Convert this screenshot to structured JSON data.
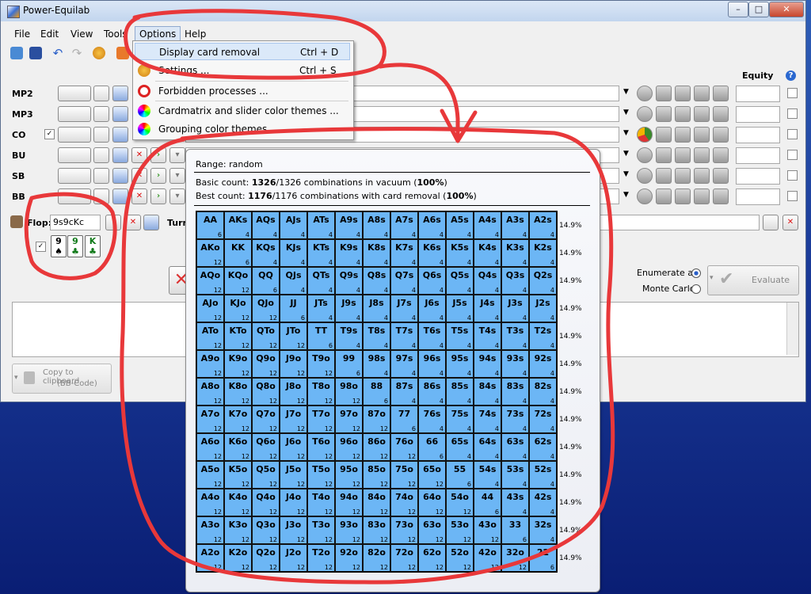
{
  "app": {
    "title": "Power-Equilab"
  },
  "menu": [
    "File",
    "Edit",
    "View",
    "Tools",
    "Options",
    "Help"
  ],
  "options_menu": [
    {
      "label": "Display card removal",
      "shortcut": "Ctrl + D",
      "icon": "none"
    },
    {
      "label": "Settings ...",
      "shortcut": "Ctrl + S",
      "icon": "gear-icon"
    },
    {
      "label": "Forbidden processes ...",
      "shortcut": "",
      "icon": "forbidden-icon"
    },
    {
      "label": "Cardmatrix and slider color themes ...",
      "shortcut": "",
      "icon": "color-wheel-icon"
    },
    {
      "label": "Grouping color themes ...",
      "shortcut": "",
      "icon": "color-wheel-icon"
    }
  ],
  "equity_header": "Equity",
  "players": [
    "MP2",
    "MP3",
    "CO",
    "BU",
    "SB",
    "BB"
  ],
  "flop": {
    "label": "Flop:",
    "value": "9s9cKc",
    "cards": [
      {
        "rank": "9",
        "suit": "♠",
        "color": "#000"
      },
      {
        "rank": "9",
        "suit": "♣",
        "color": "#127a1a"
      },
      {
        "rank": "K",
        "suit": "♣",
        "color": "#127a1a"
      }
    ]
  },
  "turn_label": "Turn",
  "evaluate": {
    "enumerate": "Enumerate all",
    "monte": "Monte Carlo",
    "button": "Evaluate"
  },
  "clipboard": {
    "line1": "Copy to clipboard",
    "line2": "(BB-Code)"
  },
  "popup": {
    "range_label": "Range: ",
    "range_value": "random",
    "basic": {
      "prefix": "Basic count: ",
      "num": "1326",
      "rest": "/1326 combinations in vacuum (",
      "pct": "100%",
      "end": ")"
    },
    "best": {
      "prefix": "Best count: ",
      "num": "1176",
      "rest": "/1176 combinations with card removal (",
      "pct": "100%",
      "end": ")"
    }
  },
  "matrix_ranks": [
    "A",
    "K",
    "Q",
    "J",
    "T",
    "9",
    "8",
    "7",
    "6",
    "5",
    "4",
    "3",
    "2"
  ],
  "matrix_counts": [
    [
      "6",
      "4",
      "4",
      "4",
      "4",
      "4",
      "4",
      "4",
      "4",
      "4",
      "4",
      "4",
      "4"
    ],
    [
      "12",
      "6",
      "4",
      "4",
      "4",
      "4",
      "4",
      "4",
      "4",
      "4",
      "4",
      "4",
      "4"
    ],
    [
      "12",
      "12",
      "6",
      "4",
      "4",
      "4",
      "4",
      "4",
      "4",
      "4",
      "4",
      "4",
      "4"
    ],
    [
      "12",
      "12",
      "12",
      "6",
      "4",
      "4",
      "4",
      "4",
      "4",
      "4",
      "4",
      "4",
      "4"
    ],
    [
      "12",
      "12",
      "12",
      "12",
      "6",
      "4",
      "4",
      "4",
      "4",
      "4",
      "4",
      "4",
      "4"
    ],
    [
      "12",
      "12",
      "12",
      "12",
      "12",
      "6",
      "4",
      "4",
      "4",
      "4",
      "4",
      "4",
      "4"
    ],
    [
      "12",
      "12",
      "12",
      "12",
      "12",
      "12",
      "6",
      "4",
      "4",
      "4",
      "4",
      "4",
      "4"
    ],
    [
      "12",
      "12",
      "12",
      "12",
      "12",
      "12",
      "12",
      "6",
      "4",
      "4",
      "4",
      "4",
      "4"
    ],
    [
      "12",
      "12",
      "12",
      "12",
      "12",
      "12",
      "12",
      "12",
      "6",
      "4",
      "4",
      "4",
      "4"
    ],
    [
      "12",
      "12",
      "12",
      "12",
      "12",
      "12",
      "12",
      "12",
      "12",
      "6",
      "4",
      "4",
      "4"
    ],
    [
      "12",
      "12",
      "12",
      "12",
      "12",
      "12",
      "12",
      "12",
      "12",
      "12",
      "6",
      "4",
      "4"
    ],
    [
      "12",
      "12",
      "12",
      "12",
      "12",
      "12",
      "12",
      "12",
      "12",
      "12",
      "12",
      "6",
      "4"
    ],
    [
      "12",
      "12",
      "12",
      "12",
      "12",
      "12",
      "12",
      "12",
      "12",
      "12",
      "12",
      "12",
      "6"
    ]
  ],
  "row_pct": [
    "14.9%",
    "14.9%",
    "14.9%",
    "14.9%",
    "14.9%",
    "14.9%",
    "14.9%",
    "14.9%",
    "14.9%",
    "14.9%",
    "14.9%",
    "14.9%",
    "14.9%"
  ],
  "colors": {
    "cell": "#6cb6f5",
    "annotation": "#e8383a"
  }
}
